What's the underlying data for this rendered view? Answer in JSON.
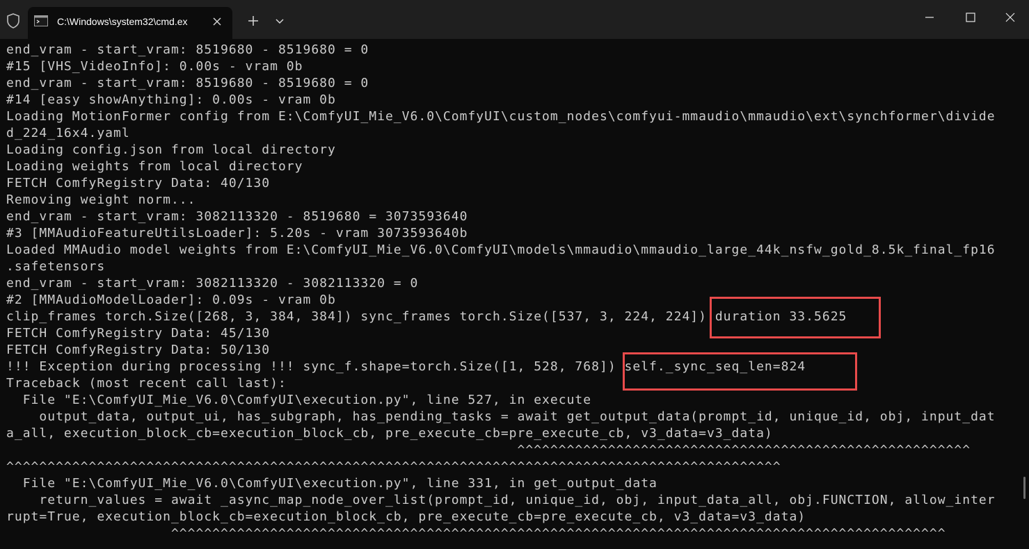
{
  "window": {
    "tab_title": "C:\\Windows\\system32\\cmd.ex",
    "icons": {
      "shield": "shield-icon",
      "tab": "console-icon",
      "tab_close": "close-icon",
      "new_tab": "plus-icon",
      "dropdown": "chevron-down-icon",
      "minimize": "minimize-icon",
      "maximize": "maximize-icon",
      "close": "close-icon"
    }
  },
  "console": {
    "lines": [
      "end_vram - start_vram: 8519680 - 8519680 = 0",
      "#15 [VHS_VideoInfo]: 0.00s - vram 0b",
      "end_vram - start_vram: 8519680 - 8519680 = 0",
      "#14 [easy showAnything]: 0.00s - vram 0b",
      "Loading MotionFormer config from E:\\ComfyUI_Mie_V6.0\\ComfyUI\\custom_nodes\\comfyui-mmaudio\\mmaudio\\ext\\synchformer\\divide",
      "d_224_16x4.yaml",
      "Loading config.json from local directory",
      "Loading weights from local directory",
      "FETCH ComfyRegistry Data: 40/130",
      "Removing weight norm...",
      "end_vram - start_vram: 3082113320 - 8519680 = 3073593640",
      "#3 [MMAudioFeatureUtilsLoader]: 5.20s - vram 3073593640b",
      "Loaded MMAudio model weights from E:\\ComfyUI_Mie_V6.0\\ComfyUI\\models\\mmaudio\\mmaudio_large_44k_nsfw_gold_8.5k_final_fp16",
      ".safetensors",
      "end_vram - start_vram: 3082113320 - 3082113320 = 0",
      "#2 [MMAudioModelLoader]: 0.09s - vram 0b",
      "clip_frames torch.Size([268, 3, 384, 384]) sync_frames torch.Size([537, 3, 224, 224]) duration 33.5625",
      "FETCH ComfyRegistry Data: 45/130",
      "FETCH ComfyRegistry Data: 50/130",
      "!!! Exception during processing !!! sync_f.shape=torch.Size([1, 528, 768]) self._sync_seq_len=824",
      "Traceback (most recent call last):",
      "  File \"E:\\ComfyUI_Mie_V6.0\\ComfyUI\\execution.py\", line 527, in execute",
      "    output_data, output_ui, has_subgraph, has_pending_tasks = await get_output_data(prompt_id, unique_id, obj, input_dat",
      "a_all, execution_block_cb=execution_block_cb, pre_execute_cb=pre_execute_cb, v3_data=v3_data)",
      "                                                              ^^^^^^^^^^^^^^^^^^^^^^^^^^^^^^^^^^^^^^^^^^^^^^^^^^^^^^^",
      "^^^^^^^^^^^^^^^^^^^^^^^^^^^^^^^^^^^^^^^^^^^^^^^^^^^^^^^^^^^^^^^^^^^^^^^^^^^^^^^^^^^^^^^^^^^^^^",
      "  File \"E:\\ComfyUI_Mie_V6.0\\ComfyUI\\execution.py\", line 331, in get_output_data",
      "    return_values = await _async_map_node_over_list(prompt_id, unique_id, obj, input_data_all, obj.FUNCTION, allow_inter",
      "rupt=True, execution_block_cb=execution_block_cb, pre_execute_cb=pre_execute_cb, v3_data=v3_data)",
      "                    ^^^^^^^^^^^^^^^^^^^^^^^^^^^^^^^^^^^^^^^^^^^^^^^^^^^^^^^^^^^^^^^^^^^^^^^^^^^^^^^^^^^^^^^^^^^^^^"
    ]
  },
  "colors": {
    "background": "#0c0c0c",
    "titlebar": "#1f1f1f",
    "text": "#cccccc",
    "highlight": "#e84b4b"
  }
}
